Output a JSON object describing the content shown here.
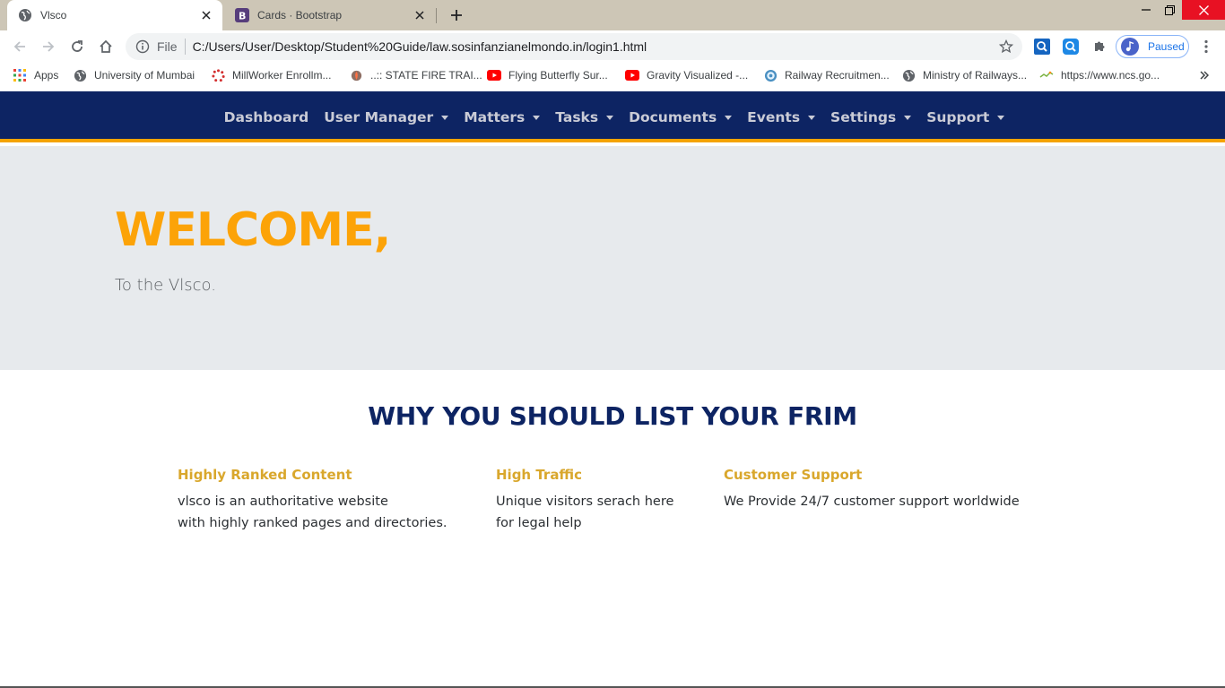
{
  "browser": {
    "tabs": [
      {
        "title": "Vlsco",
        "icon": "globe-icon",
        "active": true
      },
      {
        "title": "Cards · Bootstrap",
        "icon": "bootstrap-icon",
        "active": false
      }
    ],
    "address": {
      "scheme_label": "File",
      "url": "C:/Users/User/Desktop/Student%20Guide/law.sosinfanzianelmondo.in/login1.html"
    },
    "profile_label": "Paused",
    "bookmarks": [
      {
        "label": "Apps",
        "icon": "apps-grid-icon"
      },
      {
        "label": "University of Mumbai",
        "icon": "globe-icon"
      },
      {
        "label": "MillWorker Enrollm...",
        "icon": "loading-dots-icon"
      },
      {
        "label": "..:: STATE FIRE TRAI...",
        "icon": "fire-emblem-icon"
      },
      {
        "label": "Flying Butterfly Sur...",
        "icon": "youtube-icon"
      },
      {
        "label": "Gravity Visualized -...",
        "icon": "youtube-icon"
      },
      {
        "label": "Railway Recruitmen...",
        "icon": "railway-logo-icon"
      },
      {
        "label": "Ministry of Railways...",
        "icon": "globe-icon"
      },
      {
        "label": "https://www.ncs.go...",
        "icon": "ncs-logo-icon"
      }
    ]
  },
  "site": {
    "nav": [
      {
        "label": "Dashboard",
        "dropdown": false
      },
      {
        "label": "User Manager",
        "dropdown": true
      },
      {
        "label": "Matters",
        "dropdown": true
      },
      {
        "label": "Tasks",
        "dropdown": true
      },
      {
        "label": "Documents",
        "dropdown": true
      },
      {
        "label": "Events",
        "dropdown": true
      },
      {
        "label": "Settings",
        "dropdown": true
      },
      {
        "label": "Support",
        "dropdown": true
      }
    ],
    "hero": {
      "title": "WELCOME,",
      "subtitle": "To the Vlsco."
    },
    "features_title": "WHY YOU SHOULD LIST YOUR FRIM",
    "features": [
      {
        "title": "Highly Ranked Content",
        "lines": [
          "vlsco is an authoritative website",
          "with highly ranked pages and directories."
        ]
      },
      {
        "title": "High Traffic",
        "lines": [
          "Unique visitors serach here",
          "for legal help"
        ]
      },
      {
        "title": "Customer Support",
        "lines": [
          "We Provide 24/7 customer support worldwide"
        ]
      }
    ]
  },
  "colors": {
    "nav_bg": "#0d2463",
    "nav_border": "#f5a300",
    "hero_bg": "#e7eaed",
    "hero_title": "#fca308",
    "section_title": "#0d2463",
    "feature_title": "#d9a72c"
  }
}
